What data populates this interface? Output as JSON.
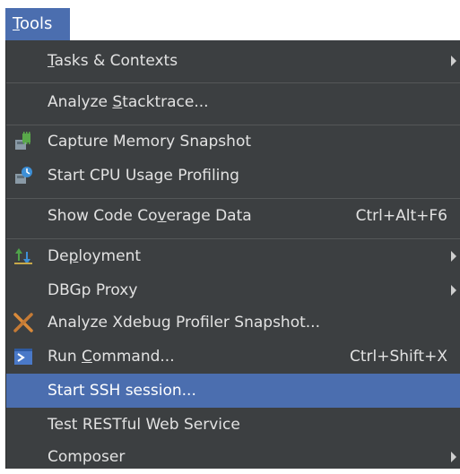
{
  "menubar": {
    "tools_prefix": "T",
    "tools_rest": "ools"
  },
  "menu": {
    "tasks": {
      "pre": "",
      "u": "T",
      "post": "asks & Contexts"
    },
    "analyze_stack": {
      "pre": "Analyze ",
      "u": "S",
      "post": "tacktrace..."
    },
    "capture_memory": {
      "label": "Capture Memory Snapshot",
      "icon": "memory-snapshot-icon"
    },
    "cpu_profiling": {
      "label": "Start CPU Usage Profiling",
      "icon": "cpu-profiling-icon"
    },
    "coverage": {
      "pre": "Show Code Co",
      "u": "v",
      "post": "erage Data",
      "shortcut": "Ctrl+Alt+F6"
    },
    "deployment": {
      "pre": "De",
      "u": "p",
      "post": "loyment",
      "icon": "deployment-icon"
    },
    "dbgp": {
      "label": "DBGp Proxy"
    },
    "xdebug": {
      "label": "Analyze Xdebug Profiler Snapshot...",
      "icon": "xdebug-icon"
    },
    "run_command": {
      "pre": "Run ",
      "u": "C",
      "post": "ommand...",
      "shortcut": "Ctrl+Shift+X",
      "icon": "terminal-icon"
    },
    "ssh": {
      "label": "Start SSH session..."
    },
    "rest": {
      "label": "Test RESTful Web Service"
    },
    "composer": {
      "label": "Composer"
    }
  },
  "colors": {
    "menu_bg": "#3c3f41",
    "selection": "#4b6eaf",
    "text": "#e2e2e2"
  }
}
